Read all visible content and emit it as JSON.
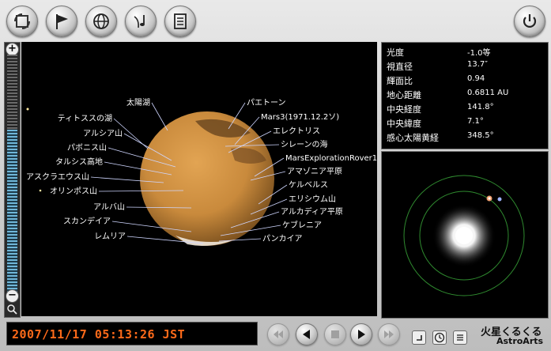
{
  "toolbar": {
    "buttons": [
      {
        "name": "rotate-view",
        "icon": "rotate-frame-icon"
      },
      {
        "name": "flag",
        "icon": "flag-icon"
      },
      {
        "name": "globe",
        "icon": "globe-icon"
      },
      {
        "name": "music",
        "icon": "music-note-icon"
      },
      {
        "name": "notes",
        "icon": "notepad-icon"
      }
    ],
    "power_icon": "power-icon"
  },
  "info": {
    "rows": [
      {
        "label": "光度",
        "value": "-1.0等"
      },
      {
        "label": "視直径",
        "value": "13.7″"
      },
      {
        "label": "輝面比",
        "value": "0.94"
      },
      {
        "label": "地心距離",
        "value": "0.6811 AU"
      },
      {
        "label": "中央経度",
        "value": "141.8°"
      },
      {
        "label": "中央緯度",
        "value": "7.1°"
      },
      {
        "label": "感心太陽黄経",
        "value": "348.5°"
      }
    ]
  },
  "map_labels": {
    "left": [
      "太陽湖",
      "ティトススの湖",
      "アルシア山",
      "パボニス山",
      "タルシス高地",
      "アスクラエウス山",
      "オリンポス山",
      "アルバ山",
      "スカンデイア",
      "レムリア"
    ],
    "right": [
      "パエトーン",
      "Mars3(1971.12.2ソ)",
      "エレクトリス",
      "シレーンの海",
      "MarsExplorationRover1(",
      "アマゾニア平原",
      "ケルベルス",
      "エリシウム山",
      "アルカディア平原",
      "ケブレニア",
      "パンカイア"
    ]
  },
  "datetime": "2007/11/17 05:13:26 JST",
  "brand": {
    "title": "火星くるくる",
    "subtitle": "AstroArts"
  },
  "colors": {
    "datetime": "#ff6a1a",
    "mars": "#c98a3c",
    "orbit": "#2f8a2f"
  }
}
